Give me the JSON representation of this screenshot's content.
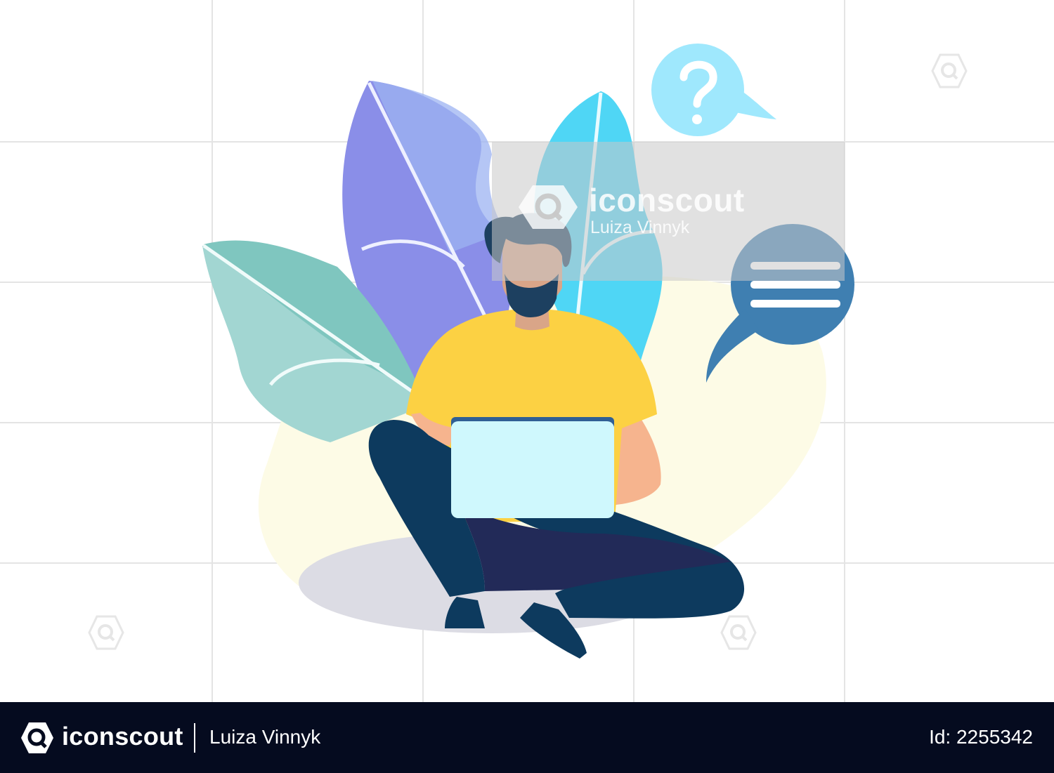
{
  "watermark": {
    "brand": "iconscout",
    "author": "Luiza Vinnyk"
  },
  "footer": {
    "brand": "iconscout",
    "author": "Luiza Vinnyk",
    "id_text": "Id: 2255342"
  },
  "colors": {
    "footer_bg": "#050b1f",
    "shirt": "#fcd143",
    "pants": "#0d3a5e",
    "laptop": "#cff8fd",
    "leaf_purple": "#8a8ee8",
    "leaf_cyan": "#4fd6f5",
    "leaf_teal": "#7fc6bf",
    "bubble_question": "#9fe8fd",
    "bubble_chat": "#3f7fb1"
  },
  "icons": [
    "question-bubble-icon",
    "chat-bubble-icon",
    "iconscout-logo-icon"
  ]
}
